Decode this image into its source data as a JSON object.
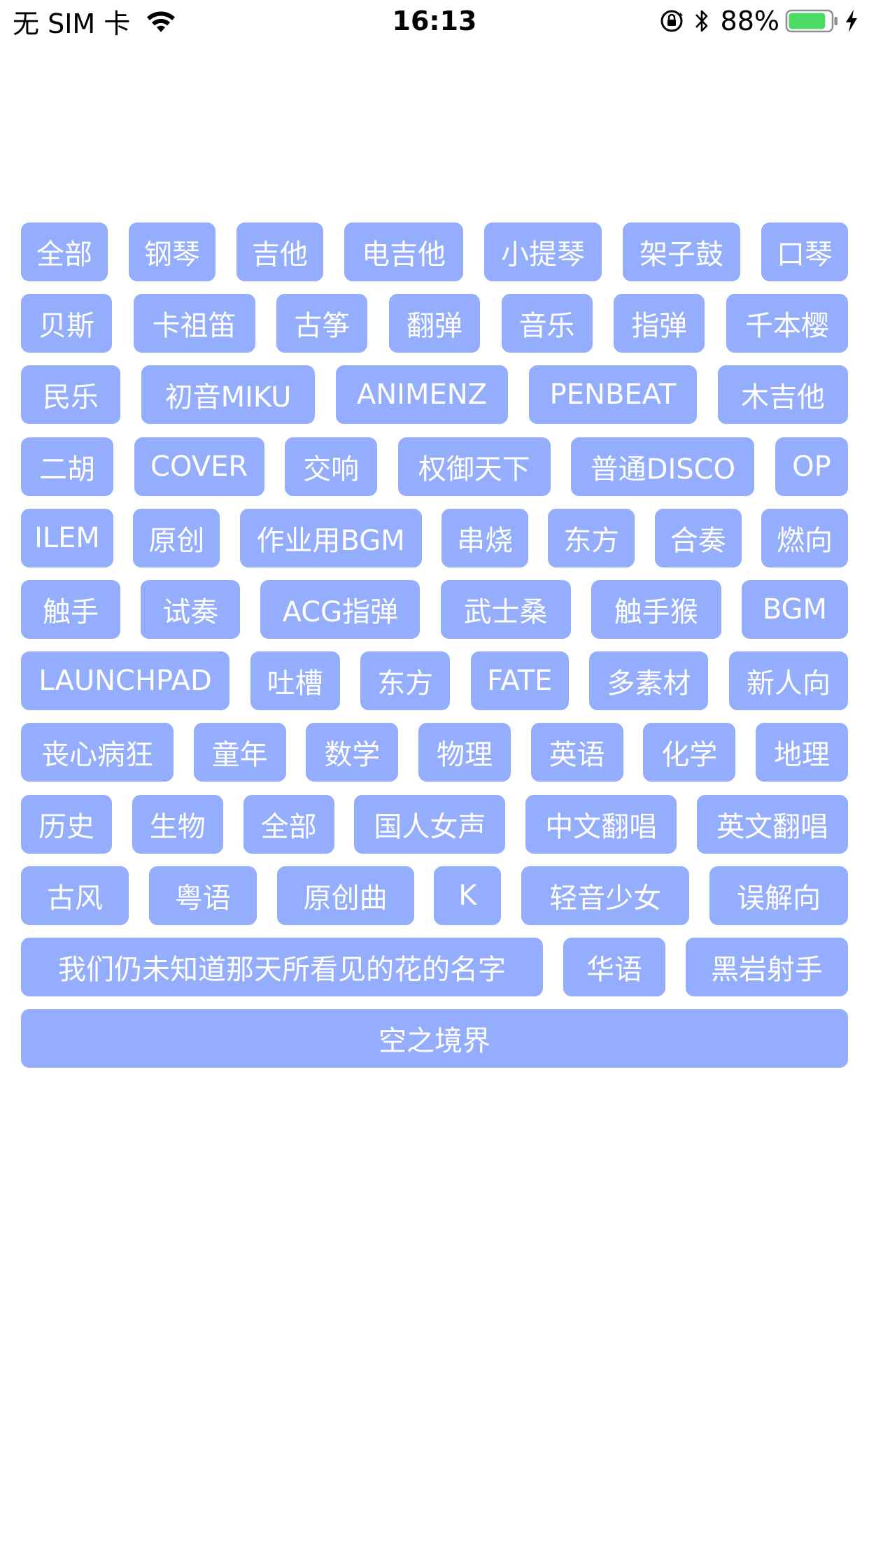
{
  "status_bar": {
    "carrier": "无 SIM 卡",
    "time": "16:13",
    "battery_percent": "88%",
    "battery_level": 0.88,
    "battery_color": "#4cd964",
    "icons": [
      "wifi-icon",
      "orientation-lock-icon",
      "bluetooth-icon",
      "battery-icon",
      "charging-icon"
    ]
  },
  "tag_color": "#94adfc",
  "tag_text_color": "#ffffff",
  "tag_rows": [
    [
      "全部",
      "钢琴",
      "吉他",
      "电吉他",
      "小提琴",
      "架子鼓",
      "口琴"
    ],
    [
      "贝斯",
      "卡祖笛",
      "古筝",
      "翻弹",
      "音乐",
      "指弹",
      "千本樱"
    ],
    [
      "民乐",
      "初音MIKU",
      "ANIMENZ",
      "PENBEAT",
      "木吉他"
    ],
    [
      "二胡",
      "COVER",
      "交响",
      "权御天下",
      "普通DISCO",
      "OP"
    ],
    [
      "ILEM",
      "原创",
      "作业用BGM",
      "串烧",
      "东方",
      "合奏",
      "燃向"
    ],
    [
      "触手",
      "试奏",
      "ACG指弹",
      "武士桑",
      "触手猴",
      "BGM"
    ],
    [
      "LAUNCHPAD",
      "吐槽",
      "东方",
      "FATE",
      "多素材",
      "新人向"
    ],
    [
      "丧心病狂",
      "童年",
      "数学",
      "物理",
      "英语",
      "化学",
      "地理"
    ],
    [
      "历史",
      "生物",
      "全部",
      "国人女声",
      "中文翻唱",
      "英文翻唱"
    ],
    [
      "古风",
      "粤语",
      "原创曲",
      "K",
      "轻音少女",
      "误解向"
    ],
    [
      "我们仍未知道那天所看见的花的名字",
      "华语",
      "黑岩射手"
    ],
    [
      "空之境界"
    ]
  ]
}
